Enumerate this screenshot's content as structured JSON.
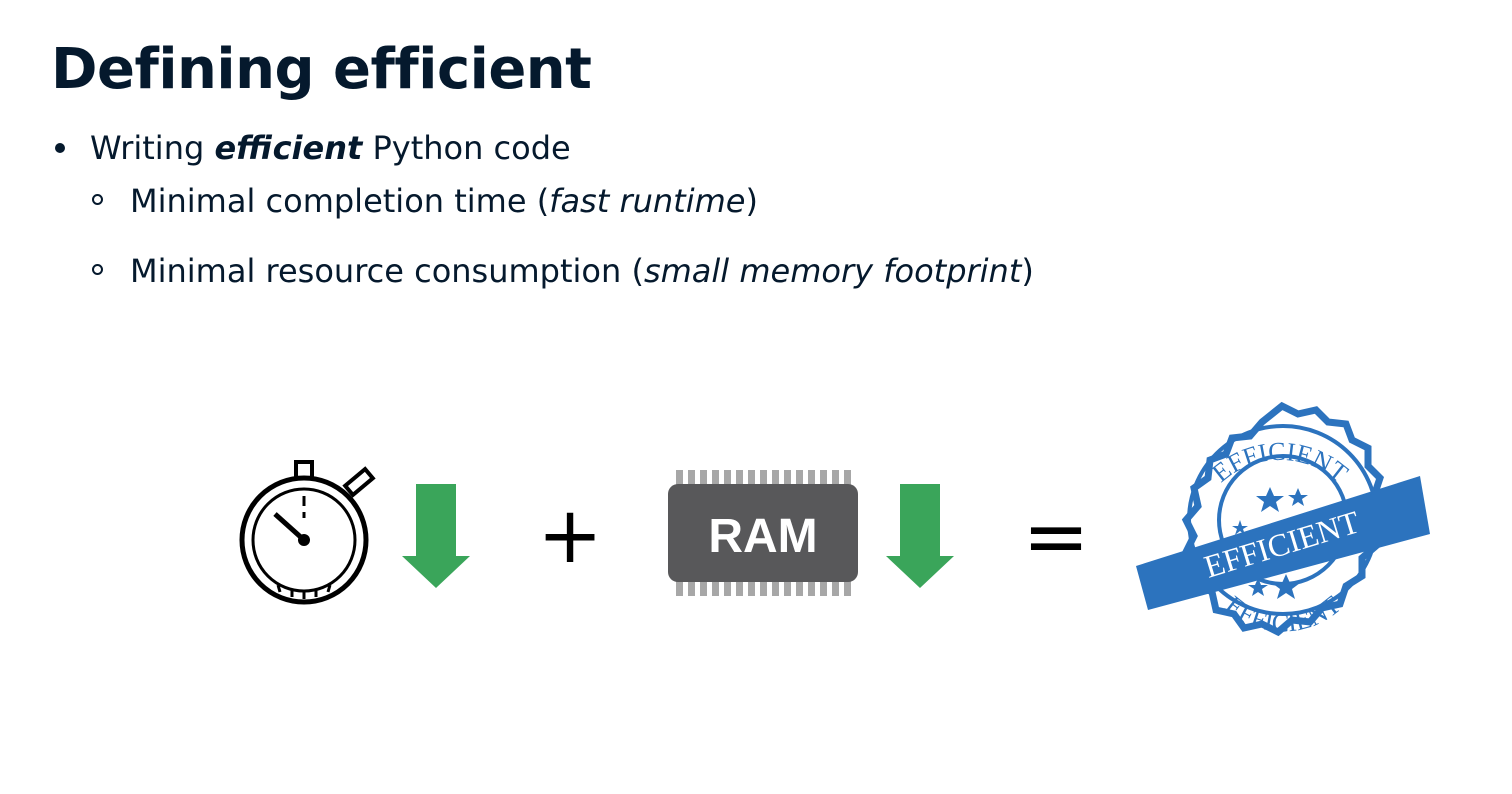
{
  "slide": {
    "title": "Defining efficient",
    "bullet1": {
      "prefix": "Writing ",
      "emphasis": "efficient",
      "suffix": " Python code"
    },
    "sub1": {
      "text": "Minimal completion time (",
      "emphasis": "fast runtime",
      "close": ")"
    },
    "sub2": {
      "text": "Minimal resource consumption (",
      "emphasis": "small memory footprint",
      "close": ")"
    }
  },
  "equation": {
    "time_icon": "stopwatch-icon",
    "arrow_icon": "down-arrow-icon",
    "plus": "+",
    "ram_label": "RAM",
    "equals": "=",
    "stamp_top": "EFFICIENT",
    "stamp_banner": "EFFICIENT",
    "stamp_bottom": "EFFICIENT",
    "colors": {
      "arrow": "#3aa55a",
      "ram_chip": "#58585a",
      "ram_pins": "#a7a7a7",
      "stamp": "#2c73be"
    }
  }
}
